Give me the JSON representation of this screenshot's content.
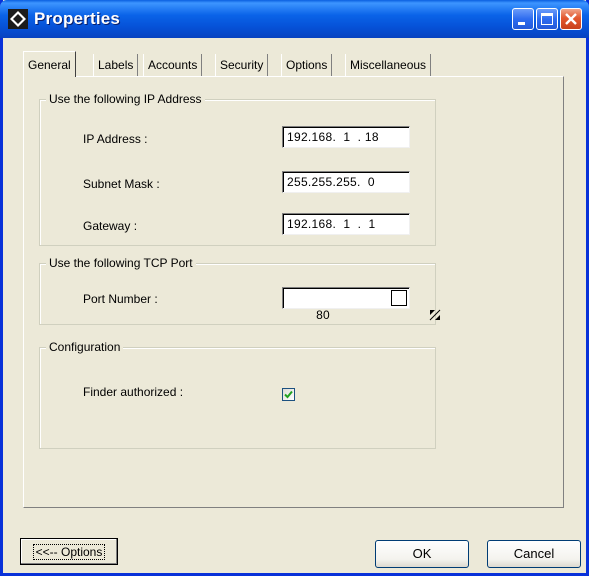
{
  "window": {
    "title": "Properties",
    "icon": "diamond-app-icon",
    "controls": [
      "minimize-icon",
      "maximize-icon",
      "close-icon"
    ]
  },
  "tabs": [
    {
      "label": "General",
      "active": true
    },
    {
      "label": "Labels",
      "active": false
    },
    {
      "label": "Accounts",
      "active": false
    },
    {
      "label": "Security",
      "active": false
    },
    {
      "label": "Options",
      "active": false
    },
    {
      "label": "Miscellaneous",
      "active": false
    }
  ],
  "ip_group": {
    "title": "Use the following IP Address",
    "ip_label": "IP Address :",
    "ip_value": "192.168.  1  . 18",
    "subnet_label": "Subnet Mask :",
    "subnet_value": "255.255.255.  0",
    "gateway_label": "Gateway :",
    "gateway_value": "192.168.  1  .  1"
  },
  "tcp_group": {
    "title": "Use the following TCP Port",
    "port_label": "Port Number :",
    "port_value": "80"
  },
  "config_group": {
    "title": "Configuration",
    "finder_label": "Finder authorized :",
    "finder_checked": true
  },
  "buttons": {
    "options": "<<-- Options",
    "ok": "OK",
    "cancel": "Cancel"
  },
  "colors": {
    "titlebar": "#0a5fe0",
    "dialog_bg": "#ece9d8",
    "close_button": "#e3582f",
    "checkmark": "#21a121"
  }
}
